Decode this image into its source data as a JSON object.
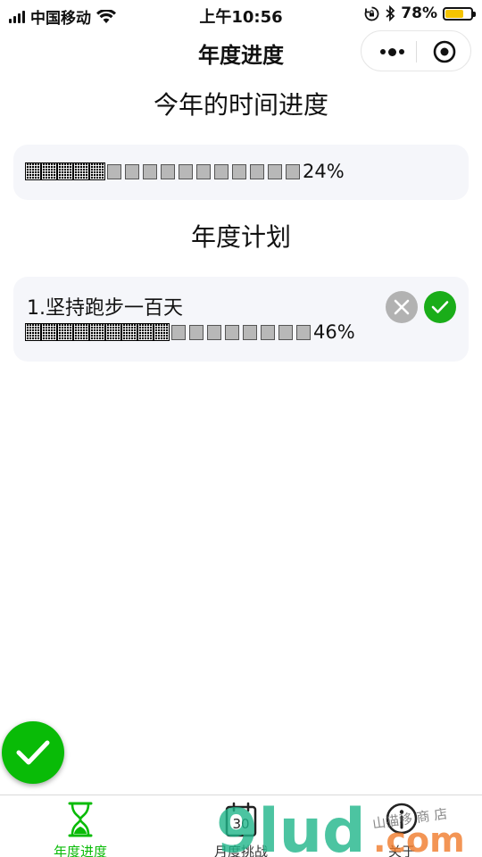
{
  "status_bar": {
    "carrier": "中国移动",
    "time": "上午10:56",
    "battery_pct": "78%",
    "battery_level": 0.78,
    "battery_color": "#f5c400"
  },
  "nav": {
    "title": "年度进度",
    "more_icon": "more-dots-icon",
    "close_icon": "target-close-icon"
  },
  "year_progress": {
    "heading": "今年的时间进度",
    "filled_blocks": 5,
    "empty_blocks": 11,
    "percent": "24%"
  },
  "plans": {
    "heading": "年度计划",
    "items": [
      {
        "title": "1.坚持跑步一百天",
        "filled_blocks": 9,
        "empty_blocks": 8,
        "percent": "46%"
      }
    ]
  },
  "colors": {
    "accent": "#09bb07",
    "done_button": "#1aad19",
    "cancel_button": "#b2b2b2",
    "card_bg": "#f5f6fa"
  },
  "tab_bar": {
    "tabs": [
      {
        "label": "年度进度",
        "icon": "hourglass-icon",
        "active": true
      },
      {
        "label": "月度挑战",
        "icon": "calendar-icon",
        "active": false
      },
      {
        "label": "关于",
        "icon": "info-icon",
        "active": false
      }
    ]
  },
  "calendar_day": "30",
  "watermark": {
    "brand": "9lud",
    "suffix": ".com",
    "tagline": "山猫移 商 店"
  }
}
